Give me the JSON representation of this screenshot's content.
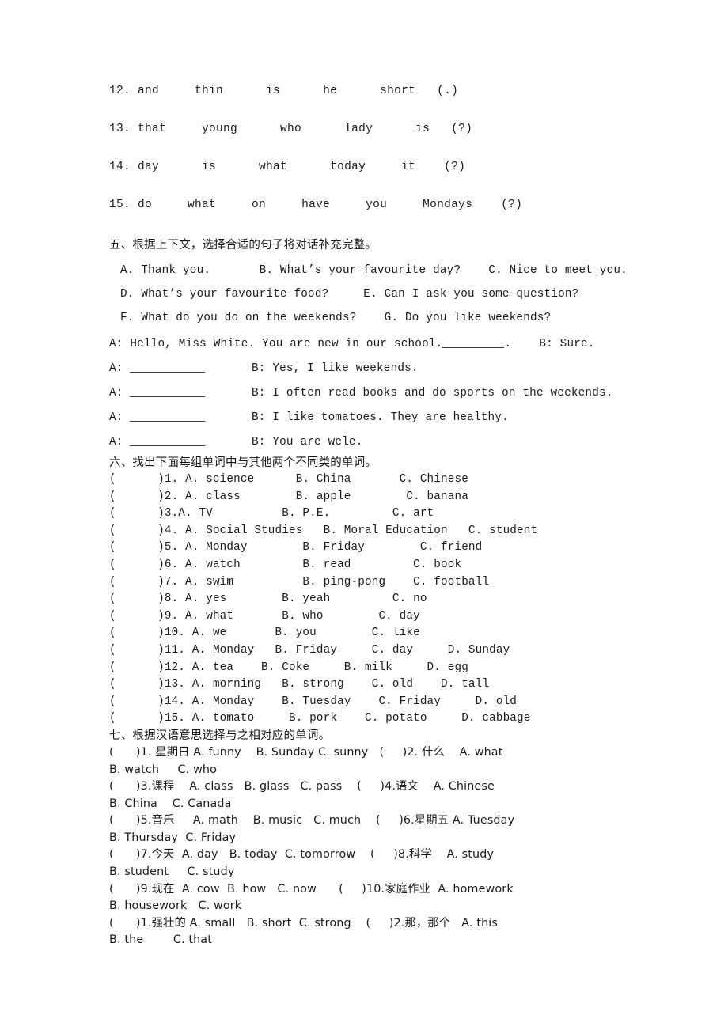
{
  "document": {
    "type": "english-exercise-worksheet",
    "language": "zh-CN/en"
  },
  "scrambled_sentences": {
    "items": [
      {
        "num": "12.",
        "words": "and     thin      is      he      short   (.)"
      },
      {
        "num": "13.",
        "words": "that     young      who      lady      is   (?)"
      },
      {
        "num": "14.",
        "words": "day      is      what      today     it    (?)"
      },
      {
        "num": "15.",
        "words": "do     what     on     have     you     Mondays    (?)"
      }
    ]
  },
  "section_five": {
    "heading": "五、根据上下文，选择合适的句子将对话补充完整。",
    "options": [
      "A. Thank you.       B. What’s your favourite day?    C. Nice to meet you.",
      "D. What’s your favourite food?     E. Can I ask you some question?",
      "F. What do you do on the weekends?    G. Do you like weekends?"
    ],
    "dialogue_intro_a": "A: Hello, Miss White. You are new in our school.",
    "dialogue_intro_blank": "_______",
    "dialogue_intro_tail": ".    B: Sure.",
    "dialogue": [
      {
        "a": "A:",
        "b": "B: Yes, I like weekends."
      },
      {
        "a": "A:",
        "b": "B: I often read books and do sports on the weekends."
      },
      {
        "a": "A:",
        "b": "B: I like tomatoes. They are healthy."
      },
      {
        "a": "A:",
        "b": "B: You are wele."
      }
    ]
  },
  "section_six": {
    "heading": "六、找出下面每组单词中与其他两个不同类的单词。",
    "items": [
      "(      )1. A. science      B. China       C. Chinese",
      "(      )2. A. class        B. apple        C. banana",
      "(      )3.A. TV          B. P.E.         C. art",
      "(      )4. A. Social Studies   B. Moral Education   C. student",
      "(      )5. A. Monday        B. Friday        C. friend",
      "(      )6. A. watch         B. read         C. book",
      "(      )7. A. swim          B. ping-pong    C. football",
      "(      )8. A. yes        B. yeah         C. no",
      "(      )9. A. what       B. who        C. day",
      "(      )10. A. we       B. you        C. like",
      "(      )11. A. Monday   B. Friday     C. day     D. Sunday",
      "(      )12. A. tea    B. Coke     B. milk     D. egg",
      "(      )13. A. morning   B. strong    C. old    D. tall",
      "(      )14. A. Monday    B. Tuesday    C. Friday     D. old",
      "(      )15. A. tomato     B. pork    C. potato     D. cabbage"
    ]
  },
  "section_seven": {
    "heading": "七、根据汉语意思选择与之相对应的单词。",
    "lines": [
      "(      )1. 星期日 A. funny    B. Sunday C. sunny   (     )2. 什么    A. what",
      "B. watch     C. who",
      "(      )3.课程    A. class   B. glass   C. pass    (     )4.语文    A. Chinese",
      "B. China    C. Canada",
      "(      )5.音乐     A. math    B. music   C. much    (     )6.星期五 A. Tuesday",
      "B. Thursday  C. Friday",
      "(      )7.今天  A. day   B. today  C. tomorrow    (     )8.科学    A. study",
      "B. student     C. study",
      "(      )9.现在  A. cow  B. how   C. now      (     )10.家庭作业  A. homework",
      "B. housework   C. work",
      "(      )1.强壮的 A. small   B. short  C. strong    (     )2.那，那个   A. this",
      "B. the        C. that"
    ]
  }
}
